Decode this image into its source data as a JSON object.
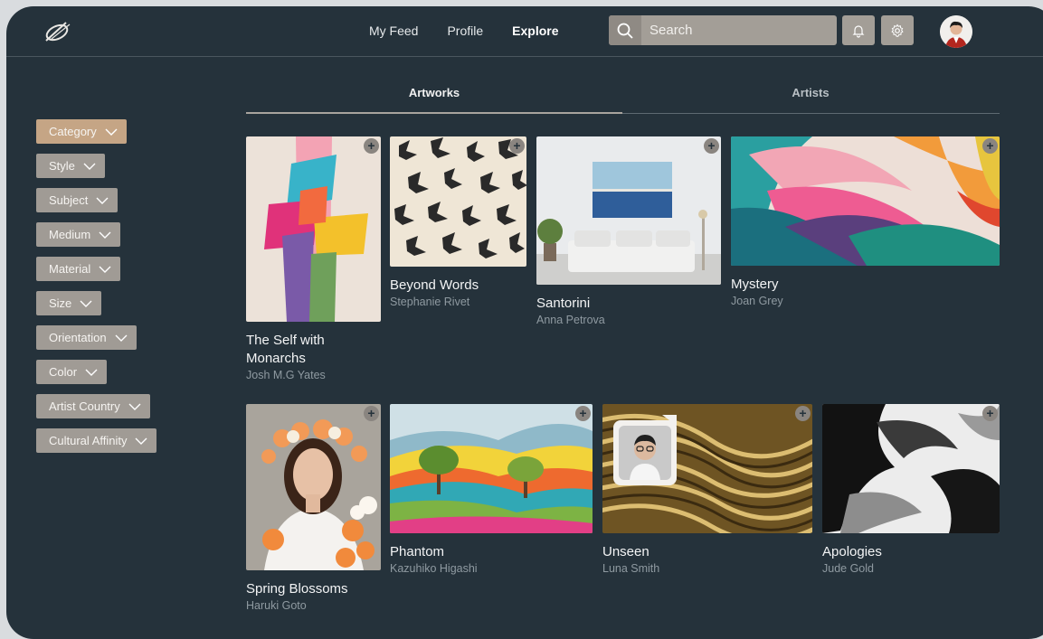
{
  "nav": {
    "items": [
      "My Feed",
      "Profile",
      "Explore"
    ],
    "active": "Explore"
  },
  "search": {
    "placeholder": "Search"
  },
  "tabs": [
    "Artworks",
    "Artists"
  ],
  "filters": [
    "Category",
    "Style",
    "Subject",
    "Medium",
    "Material",
    "Size",
    "Orientation",
    "Color",
    "Artist Country",
    "Cultural Affinity"
  ],
  "active_filter": "Category",
  "artworks": [
    {
      "title": "The Self with Monarchs",
      "artist": "Josh M.G Yates"
    },
    {
      "title": "Beyond Words",
      "artist": "Stephanie Rivet"
    },
    {
      "title": "Santorini",
      "artist": "Anna Petrova"
    },
    {
      "title": "Mystery",
      "artist": "Joan Grey"
    },
    {
      "title": "Spring Blossoms",
      "artist": "Haruki Goto"
    },
    {
      "title": "Phantom",
      "artist": "Kazuhiko Higashi"
    },
    {
      "title": "Unseen",
      "artist": "Luna Smith"
    },
    {
      "title": "Apologies",
      "artist": "Jude Gold"
    }
  ],
  "add_symbol": "+",
  "colors": {
    "background": "#25323b",
    "accent": "#c5a585",
    "chip": "#a09b95"
  }
}
